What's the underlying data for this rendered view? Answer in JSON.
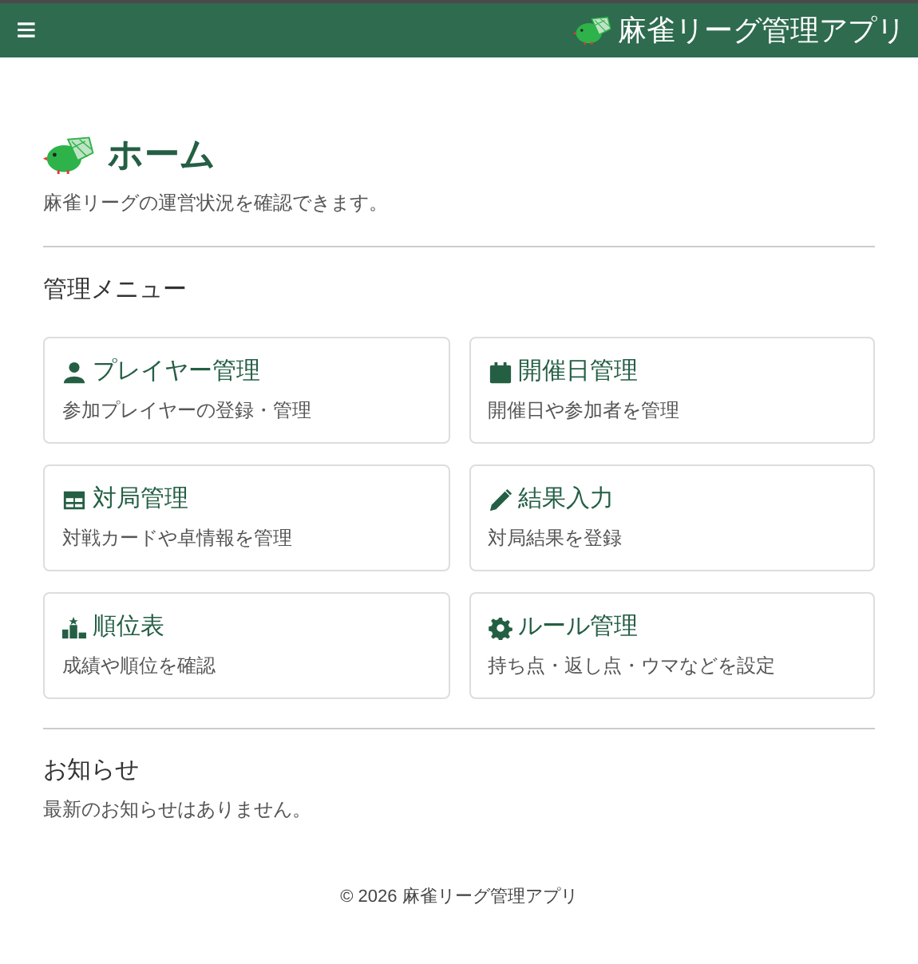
{
  "navbar": {
    "menu_glyph": "≡",
    "brand": "麻雀リーグ管理アプリ"
  },
  "page": {
    "title": "ホーム",
    "subtitle": "麻雀リーグの運営状況を確認できます。"
  },
  "menu": {
    "heading": "管理メニュー",
    "items": [
      {
        "kind": "person",
        "title": "プレイヤー管理",
        "description": "参加プレイヤーの登録・管理"
      },
      {
        "kind": "calendar",
        "title": "開催日管理",
        "description": "開催日や参加者を管理"
      },
      {
        "kind": "table",
        "title": "対局管理",
        "description": "対戦カードや卓情報を管理"
      },
      {
        "kind": "pencil",
        "title": "結果入力",
        "description": "対局結果を登録"
      },
      {
        "kind": "podium",
        "title": "順位表",
        "description": "成績や順位を確認"
      },
      {
        "kind": "gear",
        "title": "ルール管理",
        "description": "持ち点・返し点・ウマなどを設定"
      }
    ]
  },
  "notice": {
    "heading": "お知らせ",
    "text": "最新のお知らせはありません。"
  },
  "footer": "© 2026 麻雀リーグ管理アプリ"
}
